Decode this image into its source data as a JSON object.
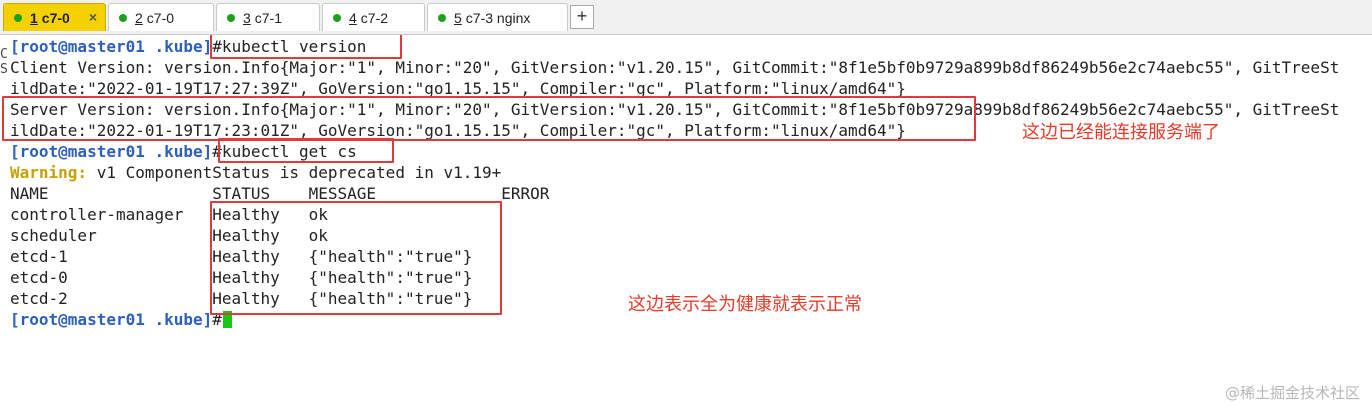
{
  "tabs": [
    {
      "num": "1",
      "label": "c7-0",
      "active": true,
      "close": "×"
    },
    {
      "num": "2",
      "label": "c7-0",
      "active": false
    },
    {
      "num": "3",
      "label": "c7-1",
      "active": false
    },
    {
      "num": "4",
      "label": "c7-2",
      "active": false
    },
    {
      "num": "5",
      "label": "c7-3 nginx",
      "active": false
    }
  ],
  "new_tab_label": "+",
  "terminal": {
    "prompt": "[root@master01 .kube]",
    "cmd1": "#kubectl version",
    "client_line1": "Client Version: version.Info{Major:\"1\", Minor:\"20\", GitVersion:\"v1.20.15\", GitCommit:\"8f1e5bf0b9729a899b8df86249b56e2c74aebc55\", GitTreeSt",
    "client_line2": "ildDate:\"2022-01-19T17:27:39Z\", GoVersion:\"go1.15.15\", Compiler:\"gc\", Platform:\"linux/amd64\"}",
    "server_line1": "Server Version: version.Info{Major:\"1\", Minor:\"20\", GitVersion:\"v1.20.15\", GitCommit:\"8f1e5bf0b9729a899b8df86249b56e2c74aebc55\", GitTreeSt",
    "server_line2": "ildDate:\"2022-01-19T17:23:01Z\", GoVersion:\"go1.15.15\", Compiler:\"gc\", Platform:\"linux/amd64\"}",
    "cmd2": "#kubectl get cs",
    "warning_label": "Warning:",
    "warning_text": " v1 ComponentStatus is deprecated in v1.19+",
    "header": "NAME                 STATUS    MESSAGE             ERROR",
    "rows": [
      "controller-manager   Healthy   ok",
      "scheduler            Healthy   ok",
      "etcd-1               Healthy   {\"health\":\"true\"}",
      "etcd-0               Healthy   {\"health\":\"true\"}",
      "etcd-2               Healthy   {\"health\":\"true\"}"
    ],
    "cmd3": "#"
  },
  "annotations": {
    "server_note": "这边已经能连接服务端了",
    "health_note": "这边表示全为健康就表示正常"
  },
  "edge_glyphs": [
    "C",
    "S"
  ],
  "watermark": "@稀土掘金技术社区"
}
